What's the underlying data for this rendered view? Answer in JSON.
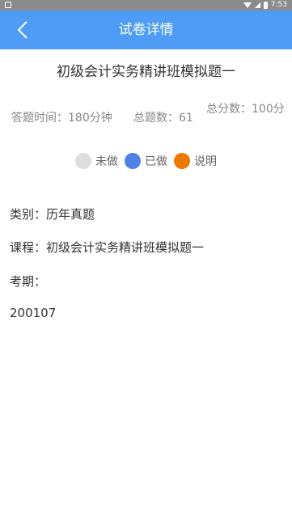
{
  "status_bar": {
    "time": "7:53"
  },
  "header": {
    "title": "试卷详情"
  },
  "exam": {
    "title": "初级会计实务精讲班模拟题一",
    "stats": {
      "time": "答题时间：180分钟",
      "count": "总题数：61",
      "score": "总分数：100分"
    }
  },
  "legend": {
    "items": [
      {
        "label": "未做",
        "color": "#dddddd"
      },
      {
        "label": "已做",
        "color": "#4e82e6"
      },
      {
        "label": "说明",
        "color": "#f07800"
      }
    ]
  },
  "details": {
    "category": "类别：历年真题",
    "course": "课程：初级会计实务精讲班模拟题一",
    "period_label": "考期：",
    "period_value": "200107"
  }
}
